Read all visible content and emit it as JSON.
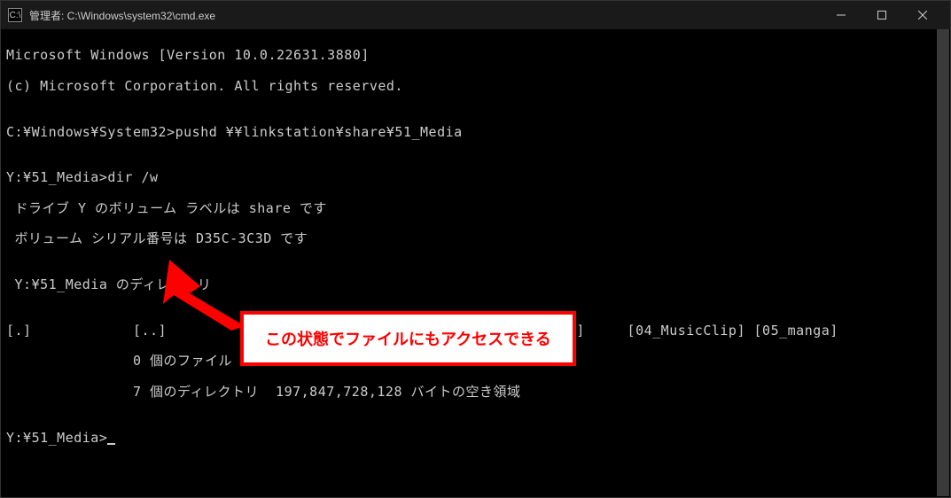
{
  "titlebar": {
    "icon_text": "C:\\",
    "title": "管理者: C:\\Windows\\system32\\cmd.exe"
  },
  "terminal": {
    "line1": "Microsoft Windows [Version 10.0.22631.3880]",
    "line2": "(c) Microsoft Corporation. All rights reserved.",
    "line3": "",
    "line4": "C:¥Windows¥System32>pushd ¥¥linkstation¥share¥51_Media",
    "line5": "",
    "line6": "Y:¥51_Media>dir /w",
    "line7": " ドライブ Y のボリューム ラベルは share です",
    "line8": " ボリューム シリアル番号は D35C-3C3D です",
    "line9": "",
    "line10": " Y:¥51_Media のディレクトリ",
    "line11": "",
    "line12": "[.]            [..]           [01_写真]      [02_動画]      [03_Music]     [04_MusicClip] [05_manga]",
    "line13": "               0 個のファイル                   0 バイト",
    "line14": "               7 個のディレクトリ  197,847,728,128 バイトの空き領域",
    "line15": "",
    "line16_prompt": "Y:¥51_Media>"
  },
  "callout": {
    "text": "この状態でファイルにもアクセスできる"
  }
}
